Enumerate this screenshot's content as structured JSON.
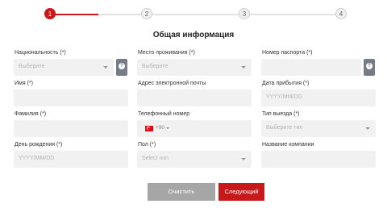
{
  "stepper": {
    "steps": [
      "1",
      "2",
      "3",
      "4"
    ],
    "active_step": 1
  },
  "form": {
    "title": "Общая информация",
    "nationality": {
      "label": "Национальность (*)",
      "placeholder": "Выберите"
    },
    "first_name": {
      "label": "Имя (*)",
      "value": ""
    },
    "last_name": {
      "label": "Фамилия (*)",
      "value": ""
    },
    "birth_date": {
      "label": "День рождения (*)",
      "placeholder": "YYYY/MM/DD"
    },
    "residence": {
      "label": "Место проживания (*)",
      "placeholder": "Выберите"
    },
    "email": {
      "label": "Адрес электронной почты",
      "value": ""
    },
    "phone": {
      "label": "Телефонный номер",
      "country_code": "+90",
      "value": ""
    },
    "gender": {
      "label": "Пол (*)",
      "placeholder": "Select non"
    },
    "passport": {
      "label": "Номер паспорта (*)",
      "value": ""
    },
    "arrival_date": {
      "label": "Дата прибытия (*)",
      "placeholder": "YYYY/MM/DD"
    },
    "departure_type": {
      "label": "Тип выезда (*)",
      "placeholder": "Выберите тип"
    },
    "company": {
      "label": "Название компании",
      "value": ""
    }
  },
  "buttons": {
    "clear": "Очистить",
    "next": "Следующий"
  },
  "colors": {
    "accent": "#c8191a",
    "field_bg": "#f1f1f1",
    "help_bg": "#757c85",
    "clear_button": "#a6a6a6"
  }
}
